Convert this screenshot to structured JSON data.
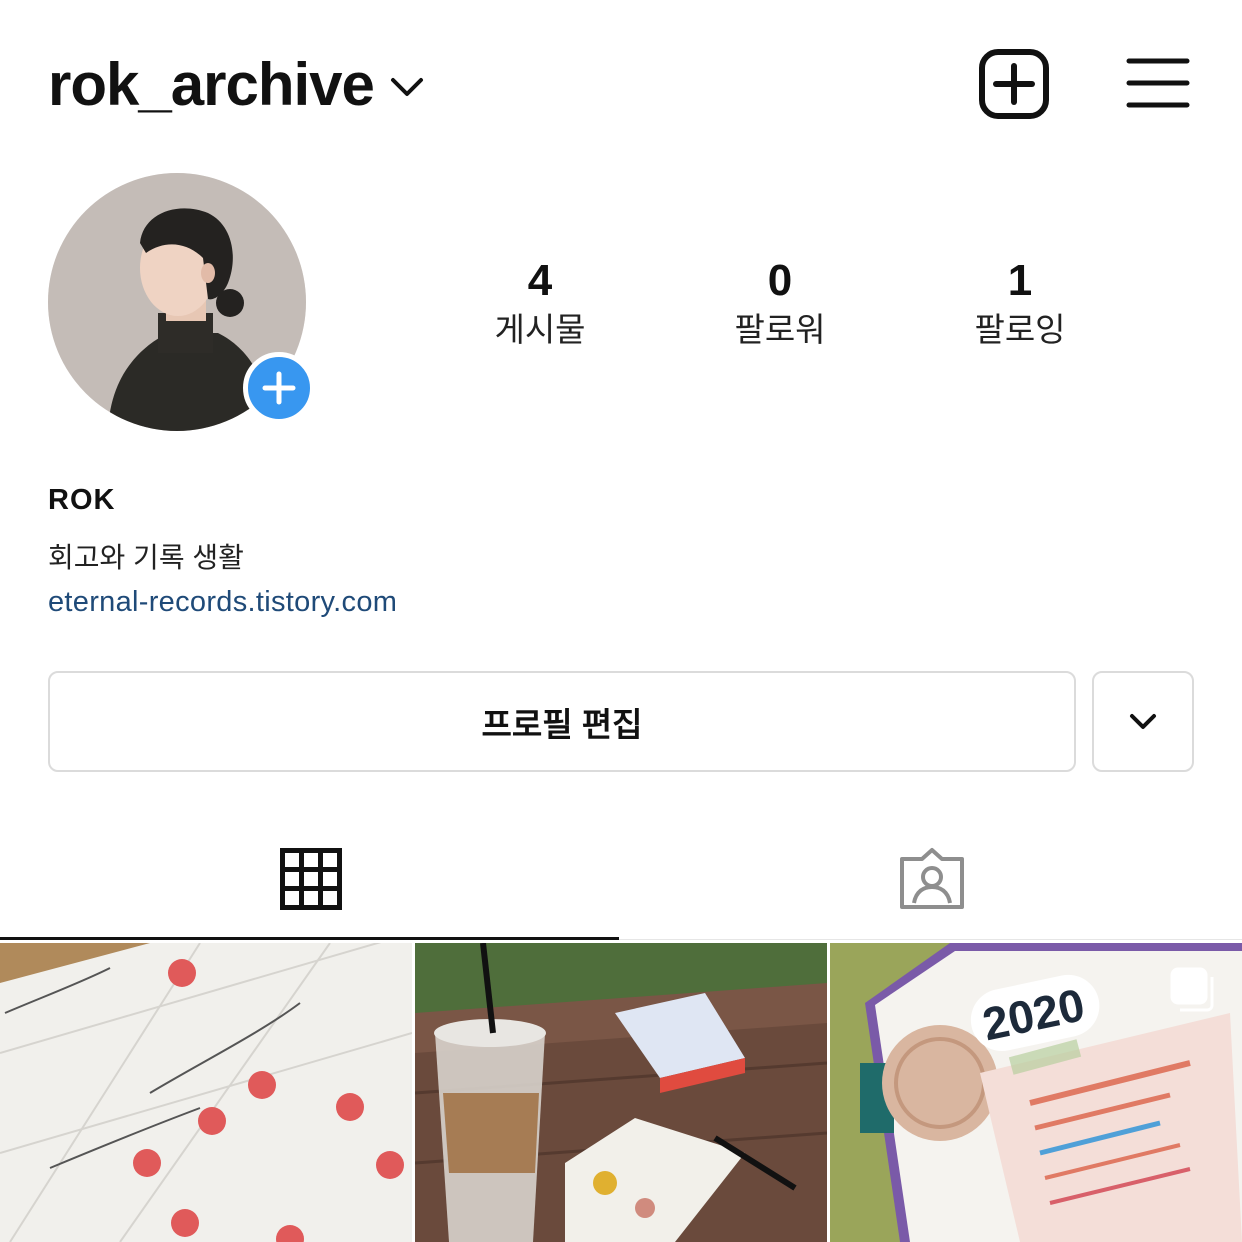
{
  "header": {
    "username": "rok_archive",
    "dropdown_icon": "chevron-down-icon",
    "add_icon": "plus-square-icon",
    "menu_icon": "hamburger-menu-icon"
  },
  "profile": {
    "add_story_icon": "plus-icon",
    "stats": [
      {
        "value": "4",
        "label": "게시물"
      },
      {
        "value": "0",
        "label": "팔로워"
      },
      {
        "value": "1",
        "label": "팔로잉"
      }
    ],
    "name": "ROK",
    "bio": "회고와 기록 생활",
    "link": "eternal-records.tistory.com"
  },
  "actions": {
    "edit_profile_label": "프로필 편집",
    "more_icon": "chevron-down-icon"
  },
  "tabs": {
    "grid_icon": "grid-icon",
    "tagged_icon": "tagged-person-icon",
    "active": "grid"
  },
  "posts": [
    {
      "kind": "calendar-planner-photo"
    },
    {
      "kind": "iced-coffee-notebook-photo"
    },
    {
      "kind": "2020-bucketlist-photo",
      "badge": "multiple-posts-icon",
      "text_visible": "2020"
    }
  ],
  "colors": {
    "accent_blue": "#3897f0",
    "link_blue": "#1f4a78",
    "border": "#dbdbdb"
  }
}
